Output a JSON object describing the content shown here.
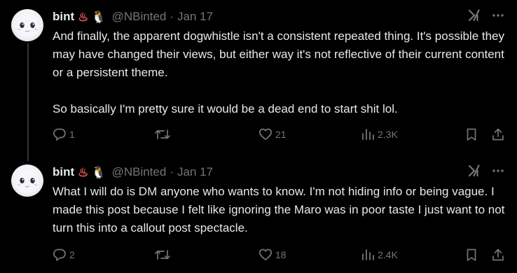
{
  "tweets": [
    {
      "display_name": "bint",
      "emoji_1": "♨",
      "emoji_2": "🐧",
      "handle": "@NBinted",
      "separator": "·",
      "date": "Jan 17",
      "text": "And finally, the apparent dogwhistle isn't a consistent repeated thing. It's possible they may have changed their views, but either way it's not reflective of their current content or a persistent theme.\n\nSo basically I'm pretty sure it would be a dead end to start shit lol.",
      "replies": "1",
      "retweets": "",
      "likes": "21",
      "views": "2.3K"
    },
    {
      "display_name": "bint",
      "emoji_1": "♨",
      "emoji_2": "🐧",
      "handle": "@NBinted",
      "separator": "·",
      "date": "Jan 17",
      "text": "What I will do is DM anyone who wants to know. I'm not hiding info or being vague. I made this post because I felt like ignoring the Maro was in poor taste I just want to not turn this into a callout post spectacle.",
      "replies": "2",
      "retweets": "",
      "likes": "18",
      "views": "2.4K"
    }
  ],
  "icons": {
    "top": [
      "grok-icon",
      "more-icon"
    ],
    "actions": [
      "reply-icon",
      "retweet-icon",
      "like-icon",
      "views-icon",
      "bookmark-icon",
      "share-icon"
    ]
  },
  "colors": {
    "background": "#000000",
    "text": "#e7e9ea",
    "muted": "#71767b",
    "thread_line": "#333639"
  }
}
